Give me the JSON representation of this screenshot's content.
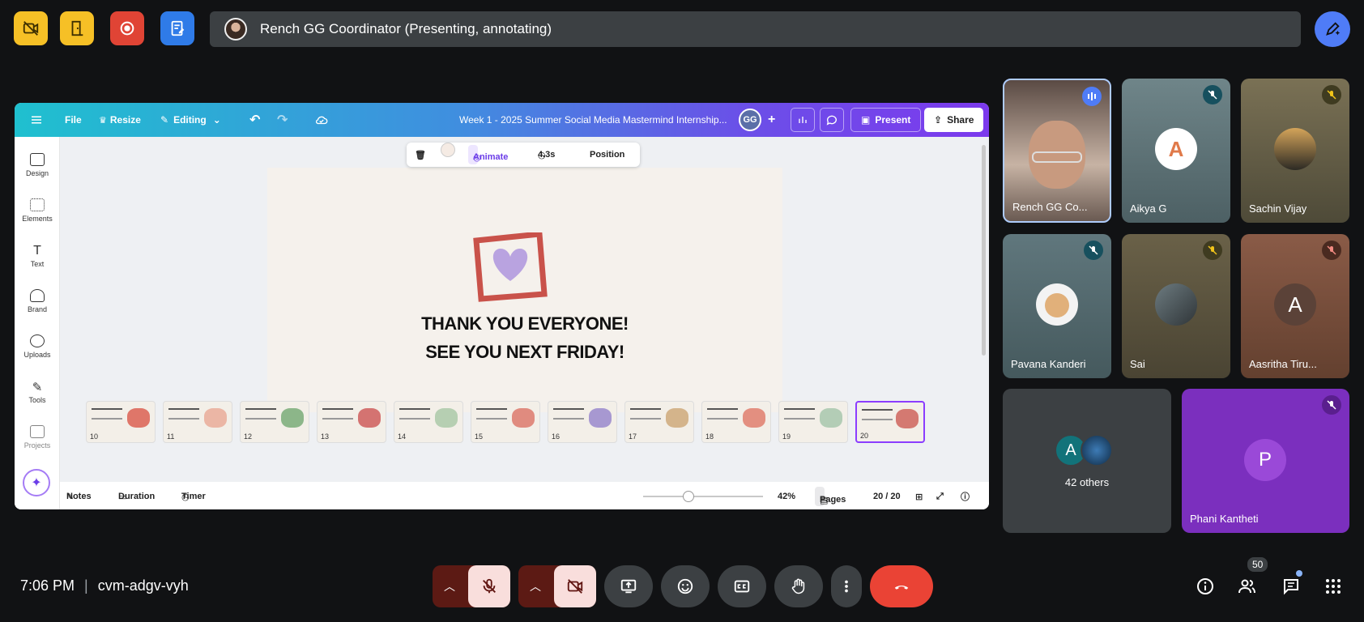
{
  "topbar": {
    "presenter_bar_text": "Rench GG Coordinator (Presenting, annotating)"
  },
  "canva": {
    "menu_file": "File",
    "menu_resize": "Resize",
    "menu_editing": "Editing",
    "doc_title": "Week 1 - 2025 Summer Social Media Mastermind Internship...",
    "avatar_initials": "GG",
    "present_label": "Present",
    "share_label": "Share",
    "sidebar": [
      {
        "label": "Design"
      },
      {
        "label": "Elements"
      },
      {
        "label": "Text"
      },
      {
        "label": "Brand"
      },
      {
        "label": "Uploads"
      },
      {
        "label": "Tools"
      },
      {
        "label": "Projects"
      }
    ],
    "toolbar": {
      "animate": "Animate",
      "duration": "4.3s",
      "position": "Position"
    },
    "slide": {
      "line1": "THANK YOU EVERYONE!",
      "line2": "SEE YOU NEXT FRIDAY!"
    },
    "thumbnails": [
      "10",
      "11",
      "12",
      "13",
      "14",
      "15",
      "16",
      "17",
      "18",
      "19",
      "20"
    ],
    "selected_thumbnail": "20",
    "bottom": {
      "notes": "Notes",
      "duration": "Duration",
      "timer": "Timer",
      "zoom": "42%",
      "pages": "Pages",
      "page_count": "20 / 20",
      "zoom_fraction": 0.38
    }
  },
  "participants": [
    {
      "name": "Rench GG Co...",
      "speaking": true
    },
    {
      "name": "Aikya G",
      "muted": true
    },
    {
      "name": "Sachin Vijay",
      "muted": true
    },
    {
      "name": "Pavana Kanderi",
      "muted": true
    },
    {
      "name": "Sai",
      "muted": true
    },
    {
      "name": "Aasritha Tiru...",
      "muted": true,
      "initial": "A"
    },
    {
      "name": "42 others",
      "initial": "A"
    },
    {
      "name": "Phani Kantheti",
      "muted": true,
      "initial": "P"
    }
  ],
  "meeting": {
    "time": "7:06 PM",
    "separator": "|",
    "code": "cvm-adgv-vyh",
    "people_count": "50"
  },
  "colors": {
    "accent_blue": "#4f7cf7",
    "end_call_red": "#ea4335",
    "purple_tile": "#7b2fbe",
    "canva_purple": "#8b3dff"
  }
}
